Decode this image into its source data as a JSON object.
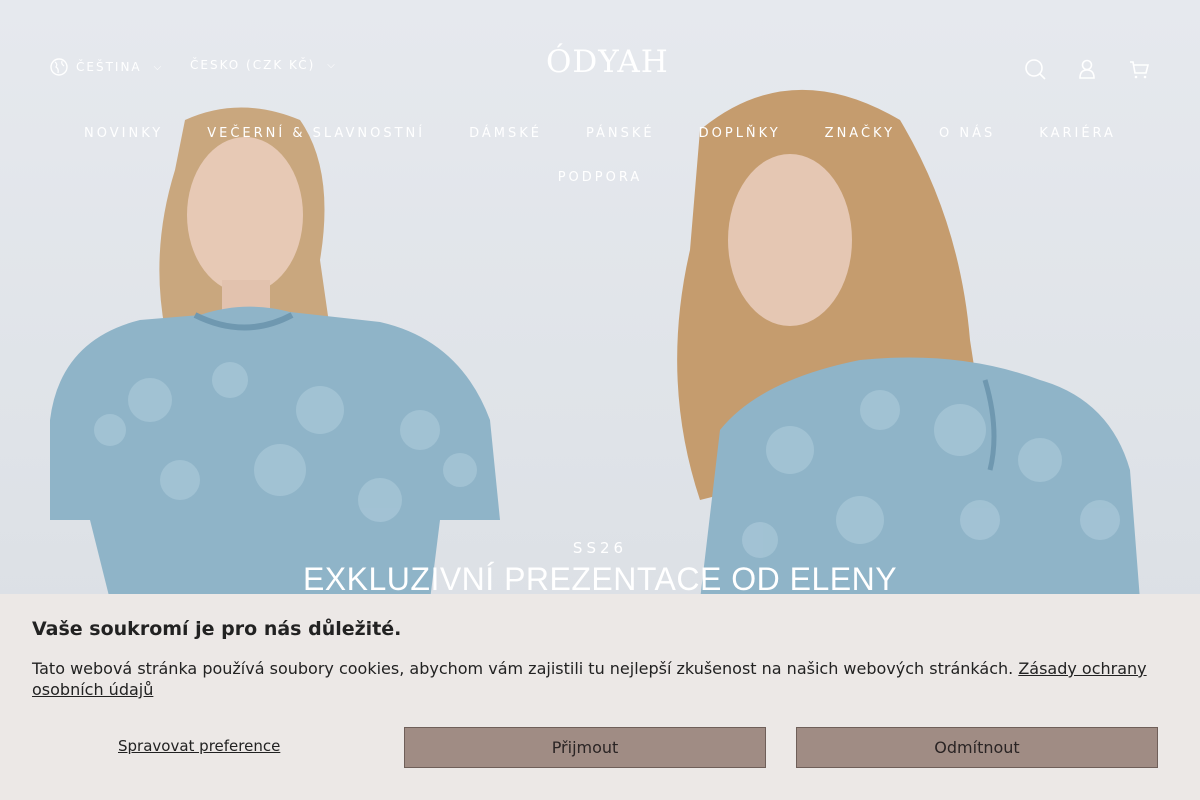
{
  "header": {
    "language_label": "ČEŠTINA",
    "country_label": "ČESKO (CZK KČ)",
    "logo_text": "ÓDYAH",
    "icons": [
      "globe-icon",
      "search-icon",
      "account-icon",
      "cart-icon",
      "chevron-down-icon"
    ]
  },
  "nav": {
    "items": [
      "NOVINKY",
      "VEČERNÍ & SLAVNOSTNÍ",
      "DÁMSKÉ",
      "PÁNSKÉ",
      "DOPLŇKY",
      "ZNAČKY",
      "O NÁS",
      "KARIÉRA"
    ],
    "items_row2": [
      "PODPORA"
    ]
  },
  "hero": {
    "season": "SS26",
    "headline": "EXKLUZIVNÍ PREZENTACE OD ELENY"
  },
  "cookie_banner": {
    "title": "Vaše soukromí je pro nás důležité.",
    "text": "Tato webová stránka používá soubory cookies, abychom vám zajistili tu nejlepší zkušenost na našich webových stránkách.",
    "policy_link": "Zásady ochrany osobních údajů",
    "manage_label": "Spravovat preference",
    "accept_label": "Přijmout",
    "reject_label": "Odmítnout"
  },
  "colors": {
    "banner_bg": "#ece8e6",
    "button_bg": "#a08c84",
    "nav_text": "#ffffff"
  }
}
